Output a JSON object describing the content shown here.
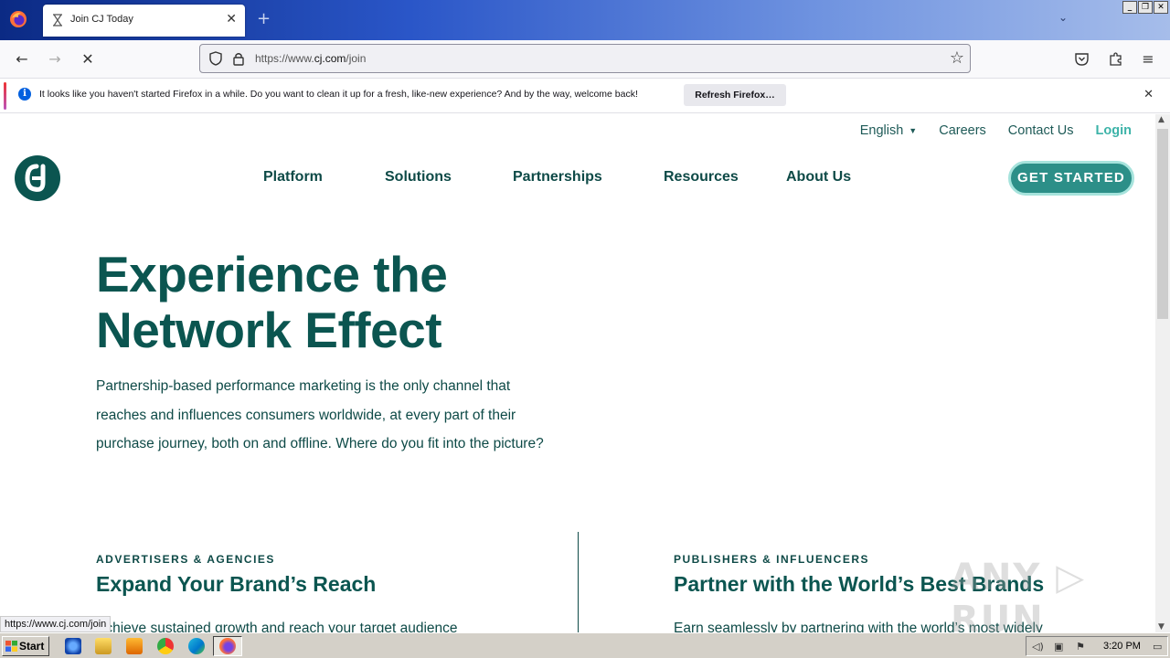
{
  "browser": {
    "tab_title": "Join CJ Today",
    "tab_close": "✕",
    "new_tab": "+",
    "url_prefix": "https://www.",
    "url_domain": "cj.com",
    "url_path": "/join",
    "window_buttons": [
      "_",
      "❐",
      "✕"
    ]
  },
  "notification": {
    "message": "It looks like you haven't started Firefox in a while. Do you want to clean it up for a fresh, like-new experience? And by the way, welcome back!",
    "button": "Refresh Firefox…",
    "close": "✕"
  },
  "site": {
    "top_links": {
      "language": "English",
      "careers": "Careers",
      "contact": "Contact Us",
      "login": "Login"
    },
    "nav": [
      "Platform",
      "Solutions",
      "Partnerships",
      "Resources",
      "About Us"
    ],
    "cta": "GET STARTED",
    "hero": {
      "title_line1": "Experience the",
      "title_line2": "Network Effect",
      "sub_line1": "Partnership-based performance marketing is the only channel that",
      "sub_line2": "reaches and influences consumers worldwide, at every part of their",
      "sub_line3": "purchase journey, both on and offline. Where do you fit into the picture?"
    },
    "left_col": {
      "eyebrow": "ADVERTISERS & AGENCIES",
      "title": "Expand Your Brand’s Reach",
      "body": "Achieve sustained growth and reach your target audience"
    },
    "right_col": {
      "eyebrow": "PUBLISHERS & INFLUENCERS",
      "title": "Partner with the World’s Best Brands",
      "body": "Earn seamlessly by partnering with the world’s most widely"
    }
  },
  "status_link": "https://www.cj.com/join",
  "watermark": "ANY ▷ RUN",
  "taskbar": {
    "start": "Start",
    "time": "3:20 PM"
  },
  "colors": {
    "brand_dark": "#0b5550",
    "brand_teal": "#2c8f88",
    "login": "#3cb3a8"
  }
}
